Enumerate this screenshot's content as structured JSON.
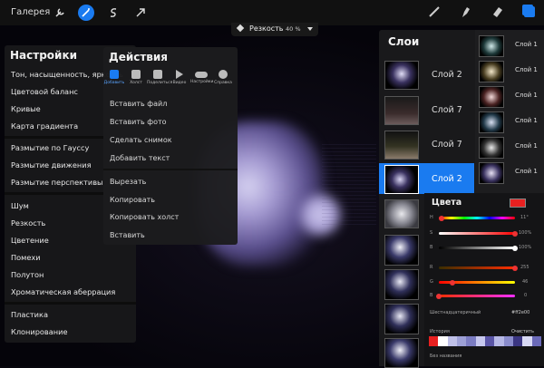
{
  "topbar": {
    "gallery": "Галерея",
    "icons": [
      "wrench-icon",
      "magic-wand-icon",
      "selection-s-icon",
      "arrow-move-icon"
    ],
    "tools": [
      "brush-icon",
      "smudge-icon",
      "eraser-icon",
      "layers-icon"
    ]
  },
  "adjust_pill": {
    "label": "Резкость",
    "value": "40 %"
  },
  "adjustments": {
    "title": "Настройки",
    "items": [
      "Тон, насыщенность, яркость",
      "Цветовой баланс",
      "Кривые",
      "Карта градиента",
      "Размытие по Гауссу",
      "Размытие движения",
      "Размытие перспективы",
      "Шум",
      "Резкость",
      "Цветение",
      "Помехи",
      "Полутон",
      "Хроматическая аберрация",
      "Пластика",
      "Клонирование"
    ]
  },
  "actions": {
    "title": "Действия",
    "tabs": [
      {
        "label": "Добавить",
        "icon": "add-icon"
      },
      {
        "label": "Холст",
        "icon": "canvas-icon"
      },
      {
        "label": "Поделиться",
        "icon": "share-icon"
      },
      {
        "label": "Видео",
        "icon": "video-icon"
      },
      {
        "label": "Настройки",
        "icon": "toggle-icon"
      },
      {
        "label": "Справка",
        "icon": "help-icon"
      }
    ],
    "items": [
      "Вставить файл",
      "Вставить фото",
      "Сделать снимок",
      "Добавить текст",
      "Вырезать",
      "Копировать",
      "Копировать холст",
      "Вставить"
    ]
  },
  "layers": {
    "title": "Слои",
    "rows": [
      "Слой 2",
      "Слой 7",
      "Слой 7",
      "Слой 2"
    ],
    "side": [
      "Слой 1",
      "Слой 1",
      "Слой 1",
      "Слой 1",
      "Слой 1",
      "Слой 1"
    ]
  },
  "colors": {
    "title": "Цвета",
    "current": "#e82020",
    "sliders": [
      {
        "label": "H",
        "value": "11°",
        "level": 0.03
      },
      {
        "label": "S",
        "value": "100%",
        "level": 1.0
      },
      {
        "label": "B",
        "value": "100%",
        "level": 1.0
      },
      {
        "label": "R",
        "value": "255",
        "level": 1.0
      },
      {
        "label": "G",
        "value": "46",
        "level": 0.18
      },
      {
        "label": "B",
        "value": "0",
        "level": 0.0
      }
    ],
    "hex_label": "Шестнадцатеричный",
    "hex_value": "#ff2e00",
    "history_label": "История",
    "clear_label": "Очистить",
    "history_swatches": [
      "#e82020",
      "#ffffff",
      "#bfc0e8",
      "#9da0d6",
      "#7b7cc2",
      "#c7c8ee",
      "#5a55a6",
      "#b6b8e6",
      "#8a8ccc",
      "#3b3682",
      "#d8d9f4",
      "#6b6ab8"
    ],
    "palette_label": "Без названия"
  }
}
